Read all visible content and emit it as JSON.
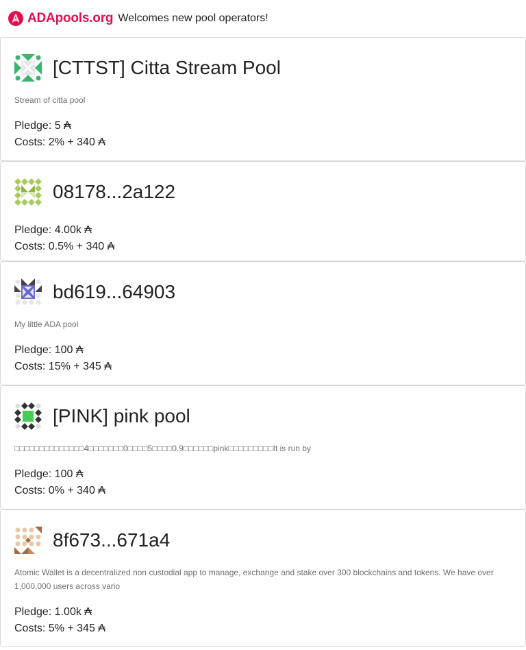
{
  "header": {
    "brand": "ADApools.org",
    "tagline": "Welcomes new pool operators!",
    "brand_color": "#e3104e"
  },
  "pools": [
    {
      "name": "[CTTST] Citta Stream Pool",
      "description": "Stream of citta pool",
      "pledge": "Pledge: 5 ₳",
      "costs": "Costs: 2% + 340 ₳",
      "identicon_color": "#3cb371"
    },
    {
      "name": "08178...2a122",
      "description": "",
      "pledge": "Pledge: 4.00k ₳",
      "costs": "Costs: 0.5% + 340 ₳",
      "identicon_color": "#a8cc5c"
    },
    {
      "name": "bd619...64903",
      "description": "My little ADA pool",
      "pledge": "Pledge: 100 ₳",
      "costs": "Costs: 15% + 345 ₳",
      "identicon_color": "#6a6ac8"
    },
    {
      "name": "[PINK] pink pool",
      "description": "□□□□□□□□□□□□□□4□□□□□□□0□□□□5□□□□0.9□□□□□□pink□□□□□□□□□It is run by",
      "pledge": "Pledge: 100 ₳",
      "costs": "Costs: 0% + 340 ₳",
      "identicon_color": "#44cc55"
    },
    {
      "name": "8f673...671a4",
      "description": "Atomic Wallet is a decentralized non custodial app to manage, exchange and stake over 300 blockchains and tokens. We have over 1,000,000 users across vario",
      "pledge": "Pledge: 1.00k ₳",
      "costs": "Costs: 5% + 345 ₳",
      "identicon_color": "#a86a3c"
    }
  ]
}
